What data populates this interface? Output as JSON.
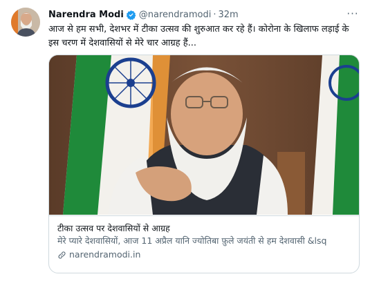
{
  "tweet": {
    "author_name": "Narendra Modi",
    "handle": "@narendramodi",
    "separator": "·",
    "time": "32m",
    "text": "आज से हम सभी, देशभर में टीका उत्सव की शुरुआत कर रहे हैं। कोरोना के खिलाफ लड़ाई के इस चरण में देशवासियों से मेरे चार आग्रह हैं...",
    "more_glyph": "···"
  },
  "card": {
    "title": "टीका उत्सव पर देशवासियों से आग्रह",
    "description": "मेरे प्यारे देशवासियों, आज 11 अप्रैल यानि ज्योतिबा फ़ुले जयंती से हम देशवासी &lsq",
    "domain": "narendramodi.in"
  },
  "colors": {
    "verified": "#1d9bf0",
    "secondary_text": "#536471",
    "border": "#cfd9de",
    "saffron": "#f29c38",
    "flag_green": "#1f8a3a",
    "chakra_blue": "#1b3f8f"
  }
}
